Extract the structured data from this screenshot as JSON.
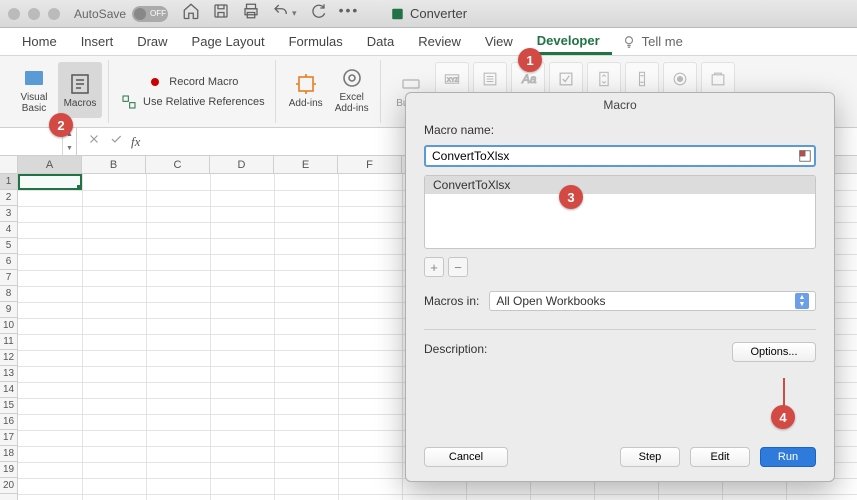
{
  "titlebar": {
    "autosave_label": "AutoSave",
    "autosave_off": "OFF",
    "document_title": "Converter"
  },
  "ribbon_tabs": [
    "Home",
    "Insert",
    "Draw",
    "Page Layout",
    "Formulas",
    "Data",
    "Review",
    "View",
    "Developer"
  ],
  "active_tab_index": 8,
  "tell_me": "Tell me",
  "ribbon": {
    "visual_basic": "Visual Basic",
    "macros": "Macros",
    "record_macro": "Record Macro",
    "use_relative": "Use Relative References",
    "addins": "Add-ins",
    "excel_addins": "Excel Add-ins",
    "button": "Button"
  },
  "namebox_value": "",
  "col_letters": [
    "A",
    "B",
    "C",
    "D",
    "E",
    "F"
  ],
  "row_numbers": [
    "1",
    "2",
    "3",
    "4",
    "5",
    "6",
    "7",
    "8",
    "9",
    "10",
    "11",
    "12",
    "13",
    "14",
    "15",
    "16",
    "17",
    "18",
    "19",
    "20"
  ],
  "dialog": {
    "title": "Macro",
    "name_label": "Macro name:",
    "name_value": "ConvertToXlsx",
    "list_items": [
      "ConvertToXlsx"
    ],
    "add_label": "+",
    "remove_label": "−",
    "macros_in_label": "Macros in:",
    "macros_in_value": "All Open Workbooks",
    "description_label": "Description:",
    "options_btn": "Options...",
    "cancel_btn": "Cancel",
    "step_btn": "Step",
    "edit_btn": "Edit",
    "run_btn": "Run"
  },
  "callouts": [
    "1",
    "2",
    "3",
    "4"
  ]
}
